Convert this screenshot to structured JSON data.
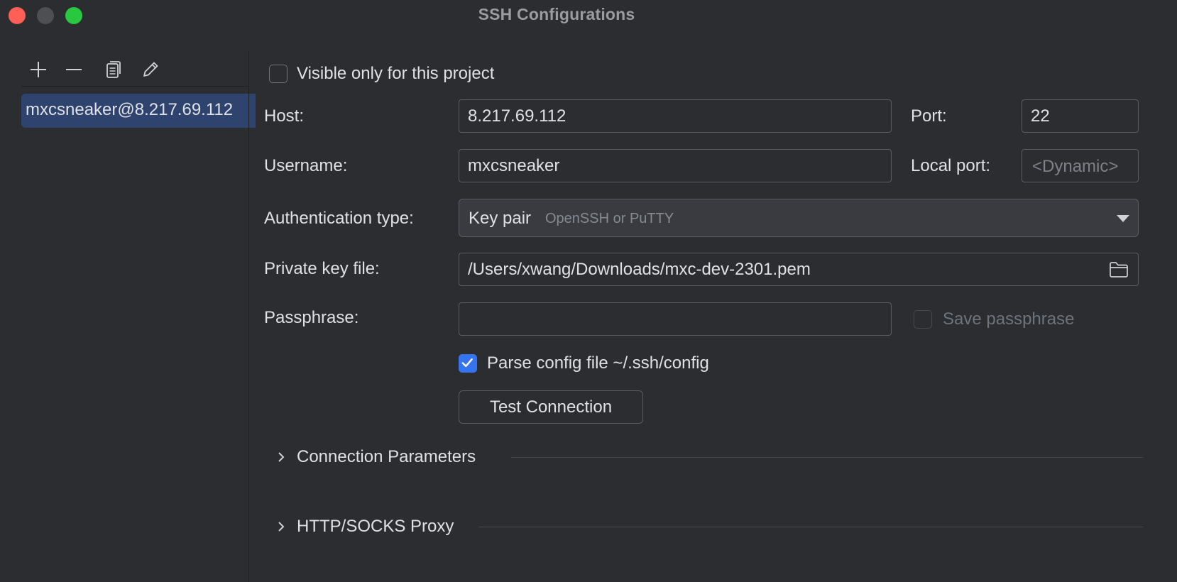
{
  "window": {
    "title": "SSH Configurations"
  },
  "toolbar": {
    "add_icon": "plus-icon",
    "remove_icon": "minus-icon",
    "copy_icon": "copy-icon",
    "edit_icon": "pencil-icon"
  },
  "hosts": [
    {
      "label": "mxcsneaker@8.217.69.112"
    }
  ],
  "form": {
    "visible_only_label": "Visible only for this project",
    "visible_only_checked": false,
    "host_label": "Host:",
    "host_value": "8.217.69.112",
    "port_label": "Port:",
    "port_value": "22",
    "username_label": "Username:",
    "username_value": "mxcsneaker",
    "local_port_label": "Local port:",
    "local_port_placeholder": "<Dynamic>",
    "auth_type_label": "Authentication type:",
    "auth_type_value": "Key pair",
    "auth_type_hint": "OpenSSH or PuTTY",
    "private_key_label": "Private key file:",
    "private_key_value": "/Users/xwang/Downloads/mxc-dev-2301.pem",
    "passphrase_label": "Passphrase:",
    "passphrase_value": "",
    "save_passphrase_label": "Save passphrase",
    "save_passphrase_checked": false,
    "parse_config_label": "Parse config file ~/.ssh/config",
    "parse_config_checked": true,
    "test_connection_label": "Test Connection"
  },
  "sections": [
    {
      "title": "Connection Parameters",
      "expanded": false
    },
    {
      "title": "HTTP/SOCKS Proxy",
      "expanded": false
    }
  ],
  "colors": {
    "background": "#2b2d30",
    "selection": "#2e436e",
    "accent": "#3574f0",
    "close": "#ff5f57",
    "maximize": "#28c840"
  }
}
